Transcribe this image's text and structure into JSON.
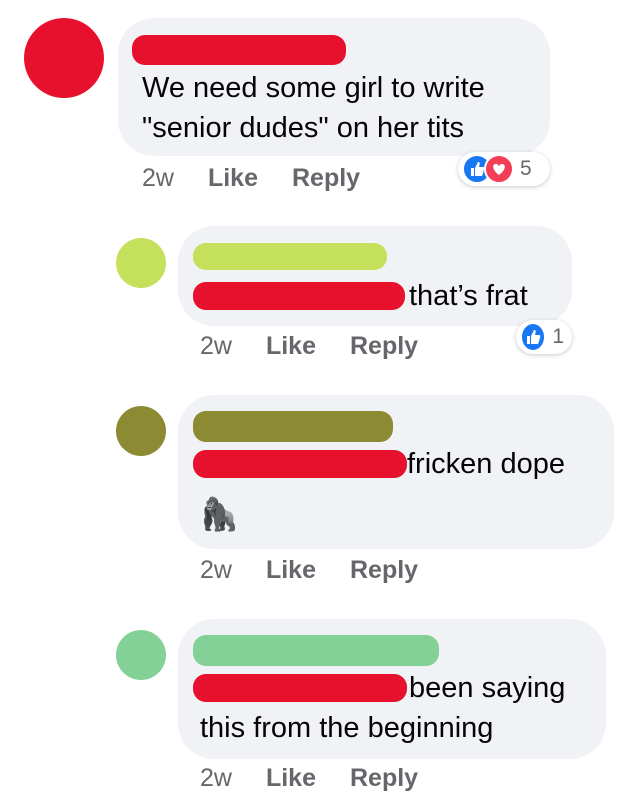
{
  "colors": {
    "redaction": "#e8112d",
    "bubble": "#f0f2f5",
    "meta_text": "#65676b",
    "like_blue": "#1877f2",
    "love_red": "#f33e58"
  },
  "comments": [
    {
      "avatar_color": "#e8112d",
      "name_bar_color": "#e8112d",
      "text_lines": [
        "We need some girl to write",
        "\"senior dudes\" on her tits"
      ],
      "time": "2w",
      "like_label": "Like",
      "reply_label": "Reply",
      "reaction_icons": [
        "like-icon",
        "love-icon"
      ],
      "reaction_count": "5"
    },
    {
      "avatar_color": "#c5e05a",
      "name_bar_color": "#c5e05a",
      "text": "that’s frat",
      "time": "2w",
      "like_label": "Like",
      "reply_label": "Reply",
      "reaction_icons": [
        "like-icon"
      ],
      "reaction_count": "1"
    },
    {
      "avatar_color": "#8c8a33",
      "name_bar_color": "#8c8a33",
      "text": "fricken dope",
      "emoji": "🦍",
      "time": "2w",
      "like_label": "Like",
      "reply_label": "Reply"
    },
    {
      "avatar_color": "#84d197",
      "name_bar_color": "#84d197",
      "text_lines": [
        "been saying",
        "this from the beginning"
      ],
      "time": "2w",
      "like_label": "Like",
      "reply_label": "Reply"
    }
  ]
}
